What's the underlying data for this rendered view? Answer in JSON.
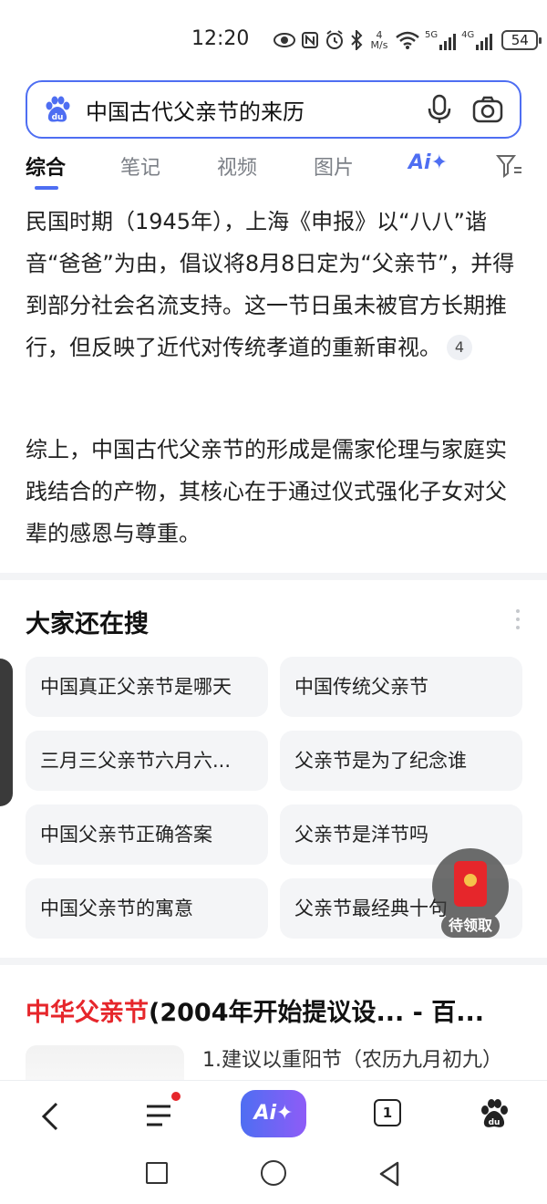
{
  "status_bar": {
    "time": "12:20",
    "network_speed": "4 M/s",
    "signal_1_label": "5G",
    "signal_2_label": "4G",
    "battery": "54",
    "icons": [
      "eye-icon",
      "nfc-icon",
      "alarm-icon",
      "bluetooth-icon",
      "wifi-icon",
      "signal-icon",
      "battery-icon"
    ]
  },
  "search": {
    "query": "中国古代父亲节的来历"
  },
  "tabs": [
    {
      "label": "综合",
      "active": true
    },
    {
      "label": "笔记"
    },
    {
      "label": "视频"
    },
    {
      "label": "图片"
    },
    {
      "label": "Ai✦"
    }
  ],
  "content": {
    "para1": "民国时期（1945年），上海《申报》以“八八”谐音“爸爸”为由，倡议将8月8日定为“父亲节”，并得到部分社会名流支持。这一节日虽未被官方长期推行，但反映了近代对传统孝道的重新审视。",
    "para1_citation": "4",
    "para2": "综上，中国古代父亲节的形成是儒家伦理与家庭实践结合的产物，其核心在于通过仪式强化子女对父辈的感恩与尊重。"
  },
  "related": {
    "title": "大家还在搜",
    "items": [
      "中国真正父亲节是哪天",
      "中国传统父亲节",
      "三月三父亲节六月六...",
      "父亲节是为了纪念谁",
      "中国父亲节正确答案",
      "父亲节是洋节吗",
      "中国父亲节的寓意",
      "父亲节最经典十句"
    ]
  },
  "floating": {
    "red_envelope_label": "待领取"
  },
  "result": {
    "title_highlight": "中华父亲节",
    "title_rest": "(2004年开始提议设... - 百...",
    "snippet": "1.建议以重阳节（农历九月初九）"
  },
  "bottom_bar": {
    "ai_label": "Ai✦",
    "tab_count": "1"
  },
  "colors": {
    "accent": "#4e6ef2",
    "highlight_red": "#e6262b",
    "chip_bg": "#f4f5f7"
  }
}
